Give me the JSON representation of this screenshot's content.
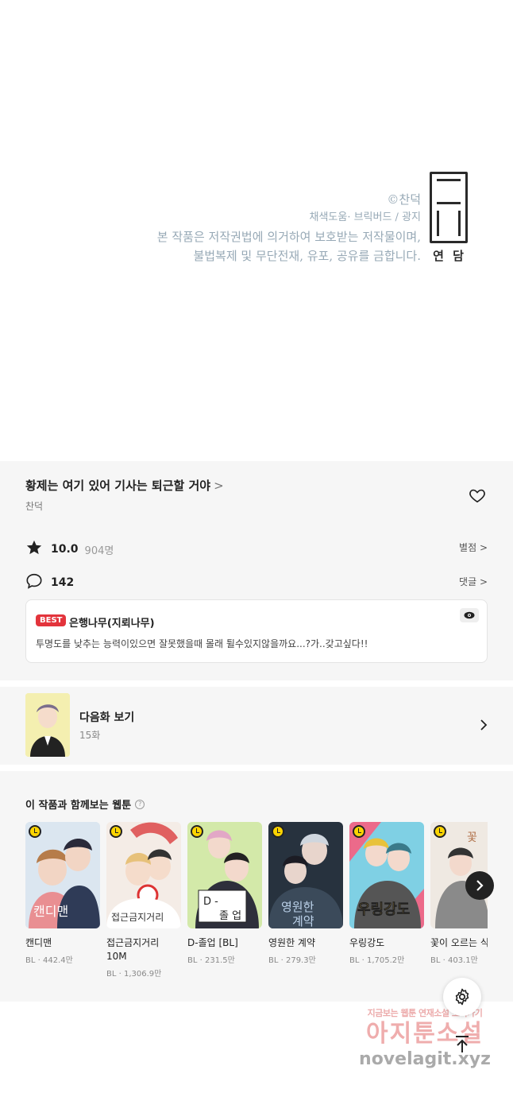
{
  "credits": {
    "copyright": "©찬덕",
    "staff": "채색도움· 브릭버드 / 광지",
    "notice_line1": "본 작품은 저작권법에 의거하여 보호받는 저작물이며,",
    "notice_line2": "불법복제 및 무단전재, 유포, 공유를 금합니다.",
    "studio_name": "연 담"
  },
  "work": {
    "title": "황제는 여기 있어 기사는 퇴근할 거야",
    "title_chevron": ">",
    "author": "찬덕"
  },
  "rating": {
    "score": "10.0",
    "count": "904명",
    "link_label": "별점 >"
  },
  "comments": {
    "count": "142",
    "link_label": "댓글 >"
  },
  "best_comment": {
    "badge": "BEST",
    "user": "은행나무(지뢰나무)",
    "text": "투명도를 낮추는 능력이있으면 잘못했을때 몰래 튈수있지않을까요...?가..갖고싶다!!"
  },
  "next_episode": {
    "title": "다음화 보기",
    "episode": "15화"
  },
  "recommendations": {
    "header": "이 작품과 함께보는 웹툰",
    "help": "?",
    "items": [
      {
        "title": "캔디맨",
        "stat": "BL · 442.4만",
        "color": "#c9d9e8",
        "accent": "#e9b7b9"
      },
      {
        "title": "접근금지거리 10M",
        "stat": "BL · 1,306.9만",
        "color": "#f1e6df",
        "accent": "#e06060"
      },
      {
        "title": "D-졸업 [BL]",
        "stat": "BL · 231.5만",
        "color": "#d0e7a6",
        "accent": "#2e2f3b"
      },
      {
        "title": "영원한 계약",
        "stat": "BL · 279.3만",
        "color": "#2d3b4a",
        "accent": "#9bb3c7"
      },
      {
        "title": "우링강도",
        "stat": "BL · 1,705.2만",
        "color": "#7fd0e4",
        "accent": "#ec6a8a"
      },
      {
        "title": "꽃이 오르는 식",
        "stat": "BL · 403.1만",
        "color": "#efe9e2",
        "accent": "#6b6b6b"
      }
    ]
  },
  "watermark": {
    "top": "지금보는 웹툰 연재소설 보러가기",
    "mid": "아지툰소설",
    "bottom": "novelagit.xyz"
  },
  "colors": {
    "panel_bg": "#f6f6f6",
    "best_badge": "#e3343c",
    "credit_text": "#97a9b6"
  }
}
